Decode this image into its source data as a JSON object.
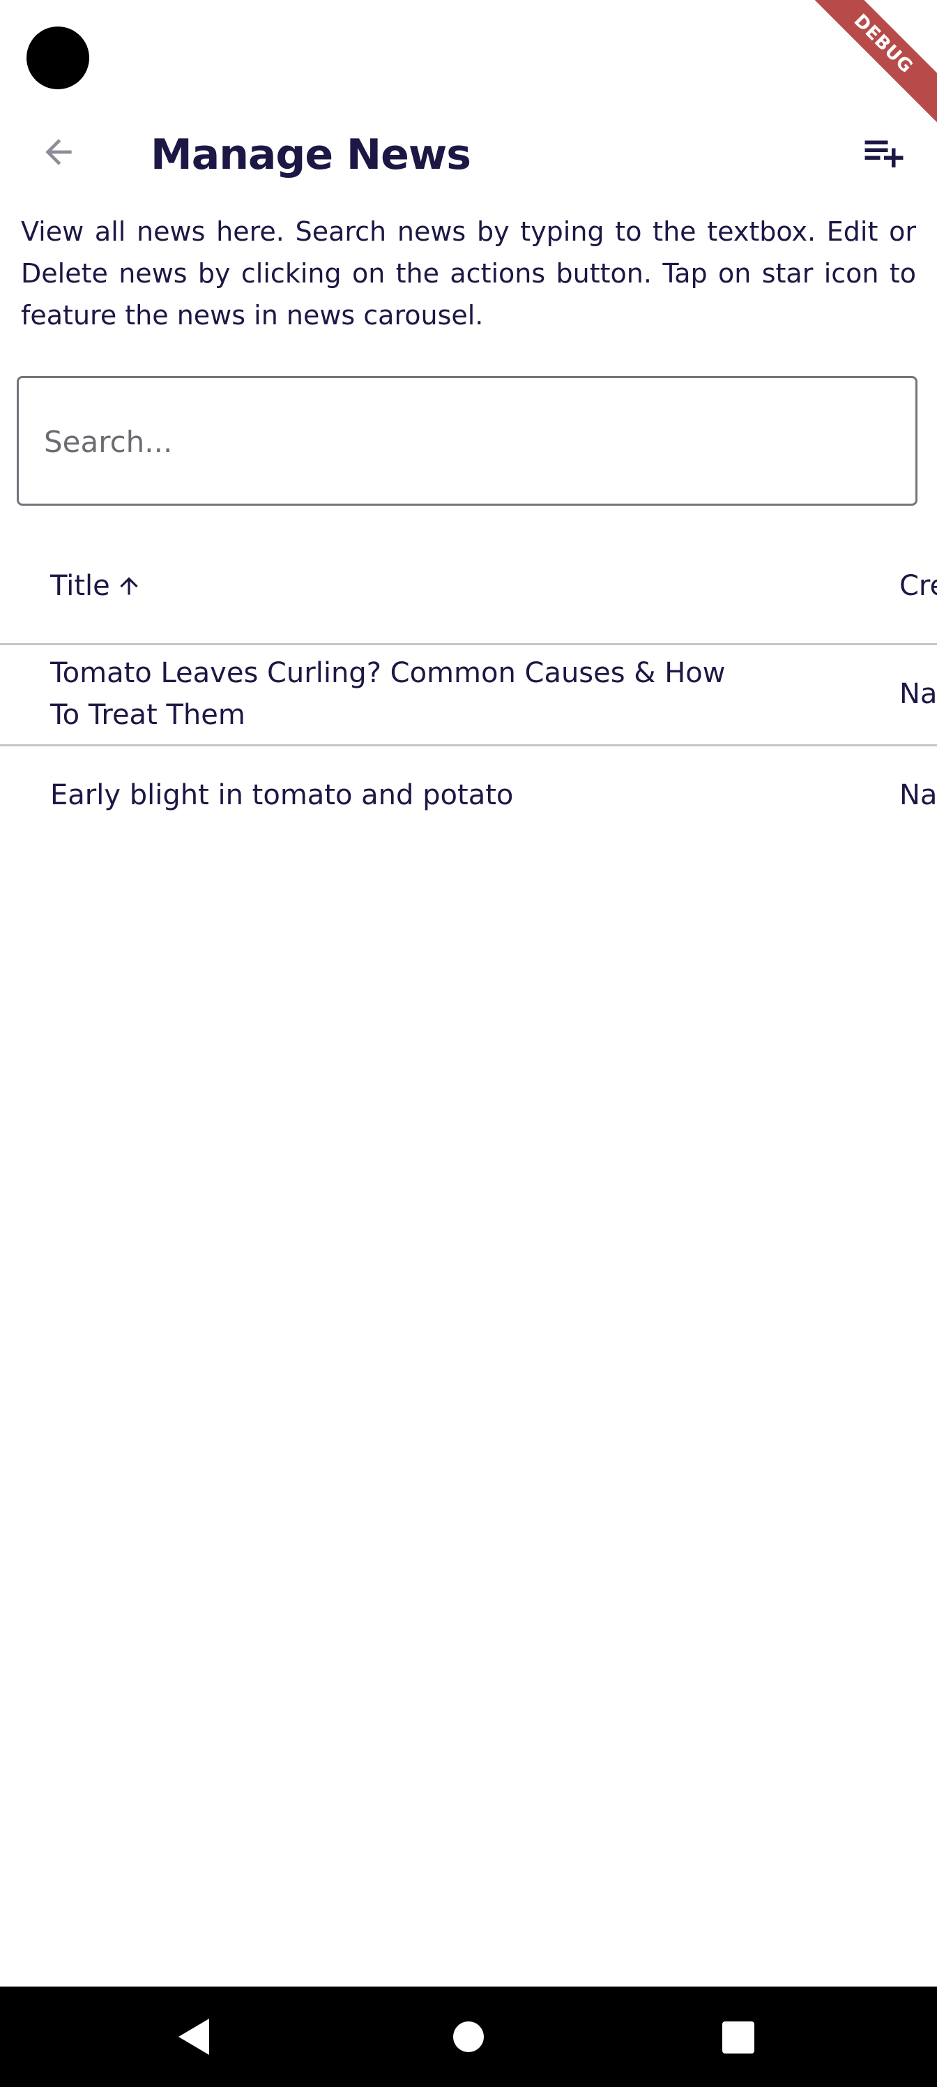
{
  "status_bar": {
    "debug_label": "DEBUG"
  },
  "app_bar": {
    "title": "Manage News",
    "back_icon": "arrow-back-icon",
    "add_icon": "playlist-add-icon"
  },
  "description": "View all news here. Search news by typing to the textbox. Edit or Delete news by clicking on the actions button. Tap on star icon to feature the news in news carousel.",
  "search": {
    "placeholder": "Search...",
    "value": ""
  },
  "table": {
    "columns": [
      {
        "label": "Title",
        "sort": "ascending",
        "sort_icon": "arrow-up-icon"
      },
      {
        "label": "Cre"
      }
    ],
    "rows": [
      {
        "title": "Tomato Leaves Curling? Common Causes & How To Treat Them",
        "created": "Na"
      },
      {
        "title": "Early blight in tomato and potato",
        "created": "Na"
      }
    ]
  },
  "nav_bar": {
    "back_icon": "nav-back-icon",
    "home_icon": "nav-home-icon",
    "recents_icon": "nav-recents-icon"
  },
  "colors": {
    "text": "#1c1845",
    "divider": "#c6c7c0",
    "outline": "#76747c",
    "debug_banner": "#b84a4a"
  }
}
